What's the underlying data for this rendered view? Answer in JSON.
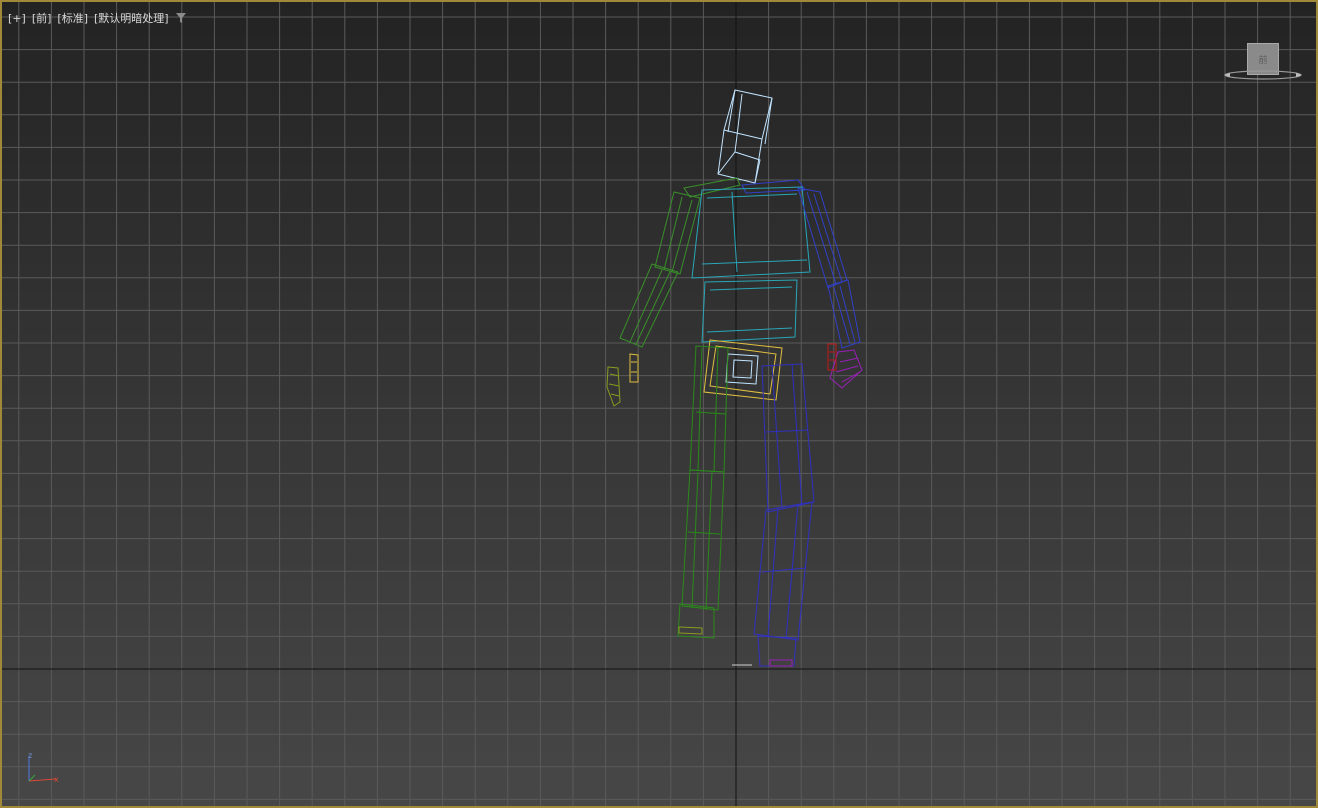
{
  "viewport": {
    "labels": [
      "[+]",
      "[前]",
      "[标准]",
      "[默认明暗处理]"
    ],
    "viewcube_label": "前",
    "axis": {
      "z": "z",
      "x": "x"
    }
  },
  "colors": {
    "frame": "#a08a3a",
    "grid": "#5a5a5a",
    "head": "#bfe3ff",
    "torso": "#2aa6b8",
    "left_arm": "#3a8f2a",
    "left_hand": "#8a9a20",
    "right_arm": "#3040c8",
    "right_hand": "#9a20b8",
    "pelvis": "#e0c040",
    "left_leg": "#2a8a1a",
    "right_leg": "#3030c0",
    "prop": "#c01818"
  }
}
